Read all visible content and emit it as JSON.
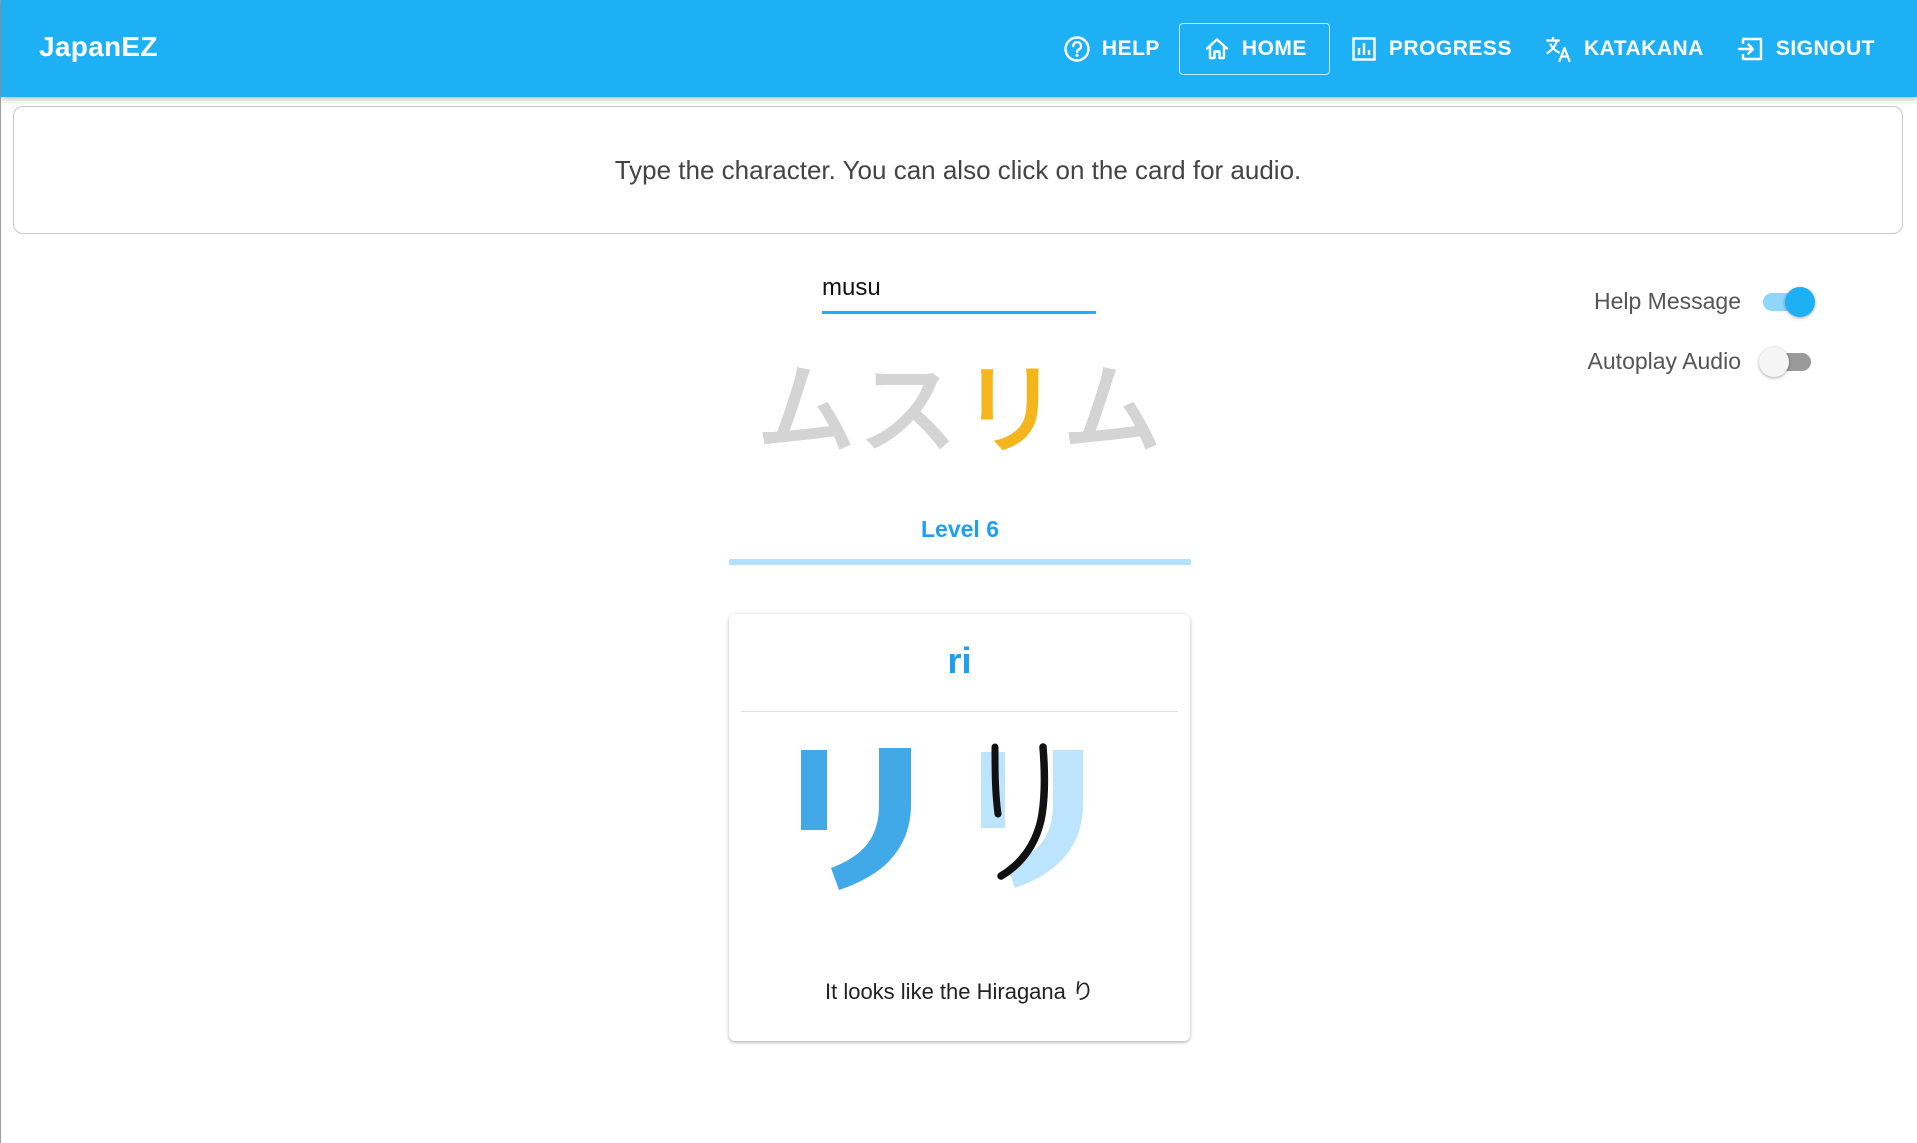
{
  "app": {
    "brand": "JapanEZ"
  },
  "nav": {
    "items": [
      {
        "label": "HELP",
        "icon": "help-circle-icon"
      },
      {
        "label": "HOME",
        "icon": "home-icon",
        "active": true
      },
      {
        "label": "PROGRESS",
        "icon": "bar-chart-icon"
      },
      {
        "label": "KATAKANA",
        "icon": "translate-icon"
      },
      {
        "label": "SIGNOUT",
        "icon": "sign-out-icon"
      }
    ]
  },
  "instruction": "Type the character. You can also click on the card for audio.",
  "answer": {
    "value": "musu",
    "placeholder": ""
  },
  "settings": {
    "help_message": {
      "label": "Help Message",
      "on": true
    },
    "autoplay_audio": {
      "label": "Autoplay Audio",
      "on": false
    }
  },
  "word": {
    "chars": [
      "ム",
      "ス",
      "リ",
      "ム"
    ],
    "current_index": 2
  },
  "level": {
    "label": "Level 6",
    "progress": 1.0
  },
  "card": {
    "romaji": "ri",
    "character": "リ",
    "hint": "It looks like the Hiragana り"
  },
  "colors": {
    "primary": "#1eb0f5",
    "highlight": "#f5b51c",
    "muted_char": "#d4d4d4",
    "glyph_solid": "#42a9e8",
    "glyph_shadow": "#bde4fd"
  }
}
